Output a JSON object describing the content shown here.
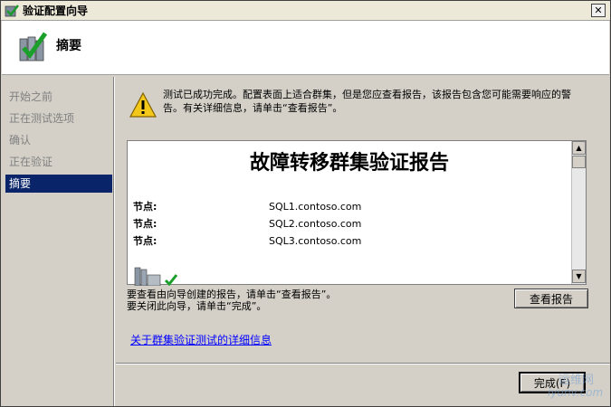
{
  "window": {
    "title": "验证配置向导",
    "close_glyph": "✕"
  },
  "header": {
    "title": "摘要",
    "icon": "validation-checkmark-icon"
  },
  "nav": {
    "items": [
      {
        "label": "开始之前",
        "active": false
      },
      {
        "label": "正在测试选项",
        "active": false
      },
      {
        "label": "确认",
        "active": false
      },
      {
        "label": "正在验证",
        "active": false
      },
      {
        "label": "摘要",
        "active": true
      }
    ]
  },
  "summary": {
    "icon": "warning-icon",
    "text": "测试已成功完成。配置表面上适合群集，但是您应查看报告，该报告包含您可能需要响应的警告。有关详细信息，请单击“查看报告”。"
  },
  "report": {
    "title": "故障转移群集验证报告",
    "rows": [
      {
        "label": "节点:",
        "value": "SQL1.contoso.com"
      },
      {
        "label": "节点:",
        "value": "SQL2.contoso.com"
      },
      {
        "label": "节点:",
        "value": "SQL3.contoso.com"
      }
    ],
    "scroll_up": "▲",
    "scroll_down": "▼"
  },
  "help": {
    "line1": "要查看由向导创建的报告，请单击“查看报告”。",
    "line2": "要关闭此向导，请单击“完成”。"
  },
  "buttons": {
    "view_report": "查看报告",
    "finish": "完成(F)"
  },
  "link": {
    "text": "关于群集验证测试的详细信息"
  },
  "watermark": {
    "line1": "运维网",
    "line2": "iyunv.com"
  },
  "colors": {
    "selection": "#0a246a",
    "link": "#0000ff",
    "dialog_bg": "#d4d0c8"
  }
}
